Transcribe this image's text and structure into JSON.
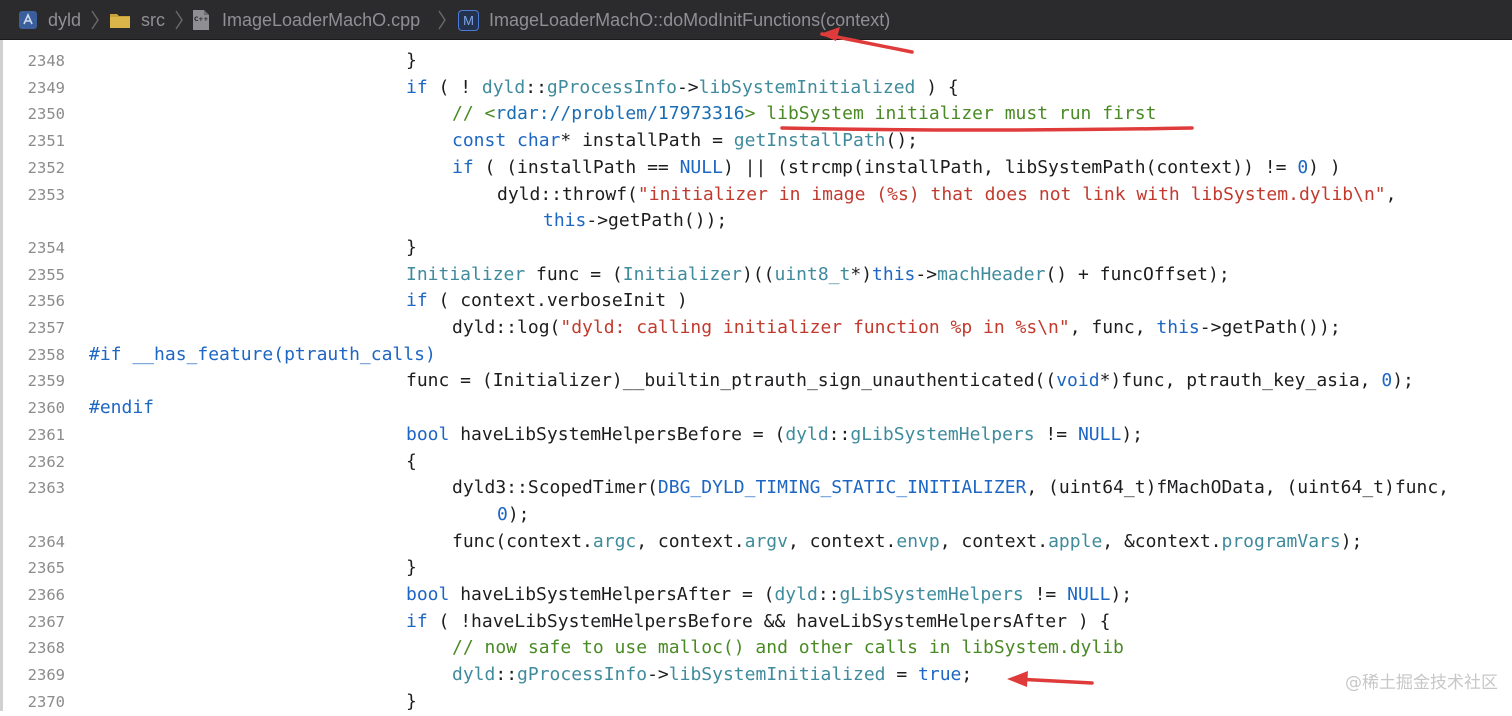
{
  "breadcrumb": {
    "project": "dyld",
    "folder": "src",
    "file": "ImageLoaderMachO.cpp",
    "method_badge": "M",
    "method": "ImageLoaderMachO::doModInitFunctions(context)",
    "file_badge": "C++"
  },
  "colors": {
    "keyword": "#1d66c4",
    "type": "#3f8b9c",
    "string": "#c23a2e",
    "comment": "#4a8a24",
    "annotation": "#e03b3b"
  },
  "gutter": [
    "2348",
    "2349",
    "2350",
    "2351",
    "2352",
    "2353",
    "2354",
    "2355",
    "2356",
    "2357",
    "2358",
    "2359",
    "2360",
    "2361",
    "2362",
    "2363",
    "2364",
    "2365",
    "2366",
    "2367",
    "2368",
    "2369",
    "2370"
  ],
  "lines": [
    [
      {
        "t": "}",
        "c": ""
      }
    ],
    [
      {
        "t": "if",
        "c": "kw"
      },
      {
        "t": " ( ! ",
        "c": ""
      },
      {
        "t": "dyld",
        "c": "ty"
      },
      {
        "t": "::",
        "c": ""
      },
      {
        "t": "gProcessInfo",
        "c": "ty"
      },
      {
        "t": "->",
        "c": ""
      },
      {
        "t": "libSystemInitialized",
        "c": "ty"
      },
      {
        "t": " ) {",
        "c": ""
      }
    ],
    [
      {
        "t": "// <",
        "c": "cm"
      },
      {
        "t": "rdar://problem/17973316",
        "c": "lnk"
      },
      {
        "t": "> libSystem initializer must run first",
        "c": "cm"
      }
    ],
    [
      {
        "t": "const",
        "c": "kw"
      },
      {
        "t": " ",
        "c": ""
      },
      {
        "t": "char",
        "c": "kw"
      },
      {
        "t": "* installPath = ",
        "c": ""
      },
      {
        "t": "getInstallPath",
        "c": "fn"
      },
      {
        "t": "();",
        "c": ""
      }
    ],
    [
      {
        "t": "if",
        "c": "kw"
      },
      {
        "t": " ( (installPath == ",
        "c": ""
      },
      {
        "t": "NULL",
        "c": "kw"
      },
      {
        "t": ") || (strcmp(installPath, libSystemPath(context)) != ",
        "c": ""
      },
      {
        "t": "0",
        "c": "num"
      },
      {
        "t": ") )",
        "c": ""
      }
    ],
    [
      {
        "t": "dyld::throwf(",
        "c": ""
      },
      {
        "t": "\"initializer in image (%s) that does not link with libSystem.dylib\\n\"",
        "c": "str"
      },
      {
        "t": ",",
        "c": ""
      }
    ],
    [
      {
        "t": "this",
        "c": "kw"
      },
      {
        "t": "->getPath());",
        "c": ""
      }
    ],
    [
      {
        "t": "}",
        "c": ""
      }
    ],
    [
      {
        "t": "Initializer",
        "c": "ty"
      },
      {
        "t": " func = (",
        "c": ""
      },
      {
        "t": "Initializer",
        "c": "ty"
      },
      {
        "t": ")((",
        "c": ""
      },
      {
        "t": "uint8_t",
        "c": "ty"
      },
      {
        "t": "*)",
        "c": ""
      },
      {
        "t": "this",
        "c": "kw"
      },
      {
        "t": "->",
        "c": ""
      },
      {
        "t": "machHeader",
        "c": "fn"
      },
      {
        "t": "() + funcOffset);",
        "c": ""
      }
    ],
    [
      {
        "t": "if",
        "c": "kw"
      },
      {
        "t": " ( context.verboseInit )",
        "c": ""
      }
    ],
    [
      {
        "t": "dyld::log(",
        "c": ""
      },
      {
        "t": "\"dyld: calling initializer function %p in %s\\n\"",
        "c": "str"
      },
      {
        "t": ", func, ",
        "c": ""
      },
      {
        "t": "this",
        "c": "kw"
      },
      {
        "t": "->getPath());",
        "c": ""
      }
    ],
    [
      {
        "t": "#if __has_feature(ptrauth_calls)",
        "c": "pp"
      }
    ],
    [
      {
        "t": "func = (Initializer)__builtin_ptrauth_sign_unauthenticated((",
        "c": ""
      },
      {
        "t": "void",
        "c": "kw"
      },
      {
        "t": "*)func, ptrauth_key_asia, ",
        "c": ""
      },
      {
        "t": "0",
        "c": "num"
      },
      {
        "t": ");",
        "c": ""
      }
    ],
    [
      {
        "t": "#endif",
        "c": "pp"
      }
    ],
    [
      {
        "t": "bool",
        "c": "kw"
      },
      {
        "t": " haveLibSystemHelpersBefore = (",
        "c": ""
      },
      {
        "t": "dyld",
        "c": "ty"
      },
      {
        "t": "::",
        "c": ""
      },
      {
        "t": "gLibSystemHelpers",
        "c": "ty"
      },
      {
        "t": " != ",
        "c": ""
      },
      {
        "t": "NULL",
        "c": "kw"
      },
      {
        "t": ");",
        "c": ""
      }
    ],
    [
      {
        "t": "{",
        "c": ""
      }
    ],
    [
      {
        "t": "dyld3::ScopedTimer(",
        "c": ""
      },
      {
        "t": "DBG_DYLD_TIMING_STATIC_INITIALIZER",
        "c": "kw"
      },
      {
        "t": ", (uint64_t)fMachOData, (uint64_t)func,",
        "c": ""
      }
    ],
    [
      {
        "t": "0",
        "c": "num"
      },
      {
        "t": ");",
        "c": ""
      }
    ],
    [
      {
        "t": "func(context.",
        "c": ""
      },
      {
        "t": "argc",
        "c": "ty"
      },
      {
        "t": ", context.",
        "c": ""
      },
      {
        "t": "argv",
        "c": "ty"
      },
      {
        "t": ", context.",
        "c": ""
      },
      {
        "t": "envp",
        "c": "ty"
      },
      {
        "t": ", context.",
        "c": ""
      },
      {
        "t": "apple",
        "c": "ty"
      },
      {
        "t": ", &context.",
        "c": ""
      },
      {
        "t": "programVars",
        "c": "ty"
      },
      {
        "t": ");",
        "c": ""
      }
    ],
    [
      {
        "t": "}",
        "c": ""
      }
    ],
    [
      {
        "t": "bool",
        "c": "kw"
      },
      {
        "t": " haveLibSystemHelpersAfter = (",
        "c": ""
      },
      {
        "t": "dyld",
        "c": "ty"
      },
      {
        "t": "::",
        "c": ""
      },
      {
        "t": "gLibSystemHelpers",
        "c": "ty"
      },
      {
        "t": " != ",
        "c": ""
      },
      {
        "t": "NULL",
        "c": "kw"
      },
      {
        "t": ");",
        "c": ""
      }
    ],
    [
      {
        "t": "if",
        "c": "kw"
      },
      {
        "t": " ( !haveLibSystemHelpersBefore && haveLibSystemHelpersAfter ) {",
        "c": ""
      }
    ],
    [
      {
        "t": "// now safe to use malloc() and other calls in libSystem.dylib",
        "c": "cm"
      }
    ],
    [
      {
        "t": "dyld",
        "c": "ty"
      },
      {
        "t": "::",
        "c": ""
      },
      {
        "t": "gProcessInfo",
        "c": "ty"
      },
      {
        "t": "->",
        "c": ""
      },
      {
        "t": "libSystemInitialized",
        "c": "ty"
      },
      {
        "t": " = ",
        "c": ""
      },
      {
        "t": "true",
        "c": "kw"
      },
      {
        "t": ";",
        "c": ""
      }
    ],
    [
      {
        "t": "}",
        "c": ""
      }
    ]
  ],
  "watermark": "@稀土掘金技术社区"
}
